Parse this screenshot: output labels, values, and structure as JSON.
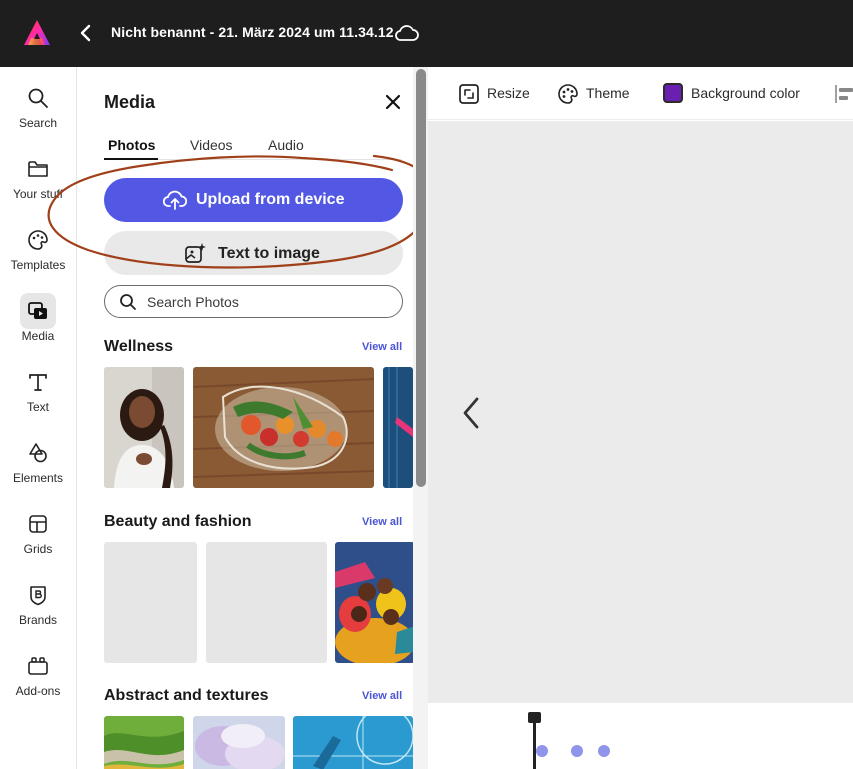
{
  "app": {
    "document_title": "Nicht benannt - 21. März 2024 um 11.34.12",
    "brand_color": "#1e1e1e"
  },
  "rail": {
    "items": [
      {
        "label": "Search",
        "icon": "search-icon"
      },
      {
        "label": "Your stuff",
        "icon": "folder-icon"
      },
      {
        "label": "Templates",
        "icon": "templates-icon"
      },
      {
        "label": "Media",
        "icon": "media-icon",
        "active": true
      },
      {
        "label": "Text",
        "icon": "text-icon"
      },
      {
        "label": "Elements",
        "icon": "elements-icon"
      },
      {
        "label": "Grids",
        "icon": "grids-icon"
      },
      {
        "label": "Brands",
        "icon": "brands-icon"
      },
      {
        "label": "Add-ons",
        "icon": "add-ons-icon"
      }
    ]
  },
  "panel": {
    "title": "Media",
    "tabs": [
      {
        "label": "Photos",
        "active": true
      },
      {
        "label": "Videos"
      },
      {
        "label": "Audio"
      }
    ],
    "upload_label": "Upload from device",
    "text_to_image_label": "Text to image",
    "search_placeholder": "Search Photos",
    "accent_color": "#5258e4",
    "sections": [
      {
        "title": "Wellness",
        "view_all": "View all"
      },
      {
        "title": "Beauty and fashion",
        "view_all": "View all"
      },
      {
        "title": "Abstract and textures",
        "view_all": "View all"
      }
    ]
  },
  "toolbar": {
    "resize_label": "Resize",
    "theme_label": "Theme",
    "background_label": "Background color",
    "background_color": "#6a1fb0"
  },
  "annotation": {
    "color": "#a0401a"
  }
}
